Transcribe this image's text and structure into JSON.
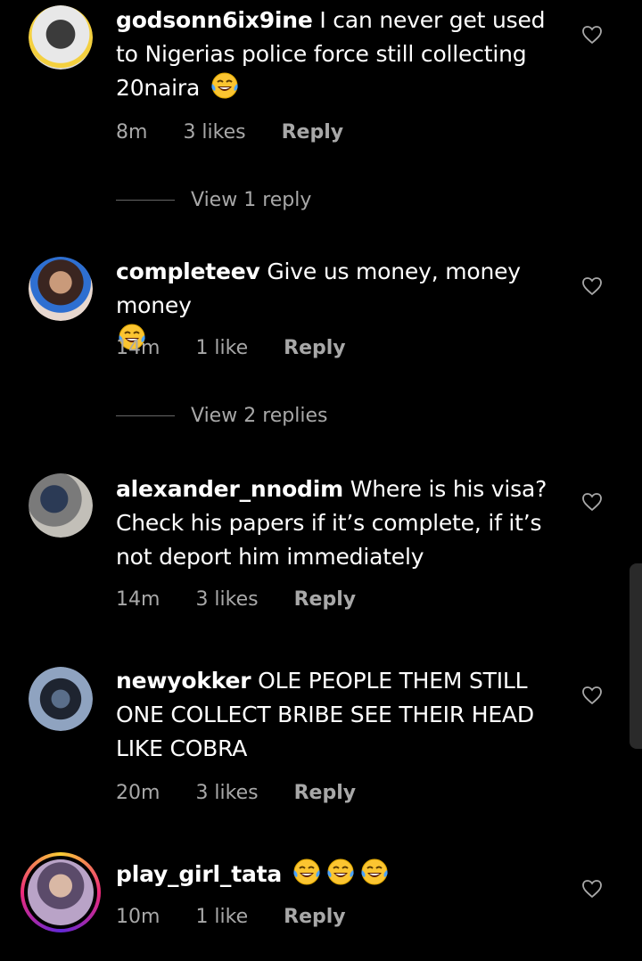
{
  "comments": [
    {
      "username": "godsonn6ix9ine",
      "text": "I can never get used to Nigerias police force still collecting 20naira",
      "emoji_count": 1,
      "time": "8m",
      "likes": "3 likes",
      "reply_label": "Reply",
      "view_replies": "View 1 reply"
    },
    {
      "username": "completeev",
      "text": "Give us money, money money",
      "emoji_count": 1,
      "time": "14m",
      "likes": "1 like",
      "reply_label": "Reply",
      "view_replies": "View 2 replies"
    },
    {
      "username": "alexander_nnodim",
      "text": "Where is his visa? Check his papers if it’s complete, if it’s not deport him immediately",
      "emoji_count": 0,
      "time": "14m",
      "likes": "3 likes",
      "reply_label": "Reply"
    },
    {
      "username": "newyokker",
      "text": "OLE PEOPLE THEM STILL ONE COLLECT BRIBE SEE THEIR HEAD LIKE COBRA",
      "emoji_count": 0,
      "time": "20m",
      "likes": "3 likes",
      "reply_label": "Reply"
    },
    {
      "username": "play_girl_tata",
      "text": "",
      "emoji_count": 3,
      "time": "10m",
      "likes": "1 like",
      "reply_label": "Reply"
    }
  ],
  "icons": {
    "like": "heart-outline-icon",
    "emoji": "face-with-tears-of-joy-emoji"
  },
  "colors": {
    "background": "#000000",
    "meta_text": "#a8a8a8",
    "story_ring": [
      "#f9ce34",
      "#ee2a7b",
      "#6228d7"
    ]
  }
}
